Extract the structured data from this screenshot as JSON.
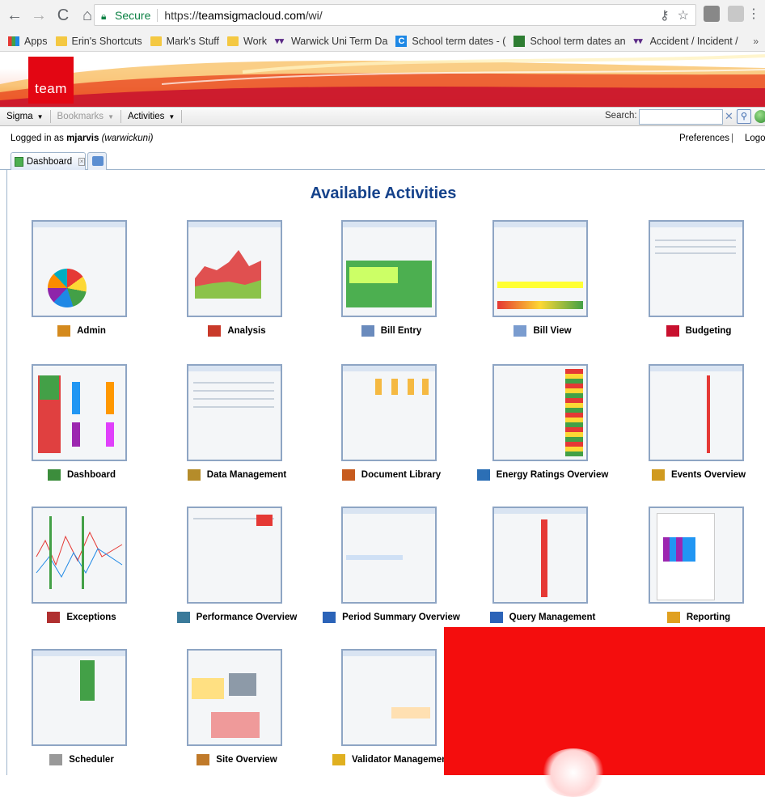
{
  "browser": {
    "secure_label": "Secure",
    "url_scheme": "https://",
    "url_host": "teamsigmacloud.com",
    "url_path": "/wi/",
    "bookmarks": [
      {
        "label": "Apps",
        "icon": "apps-icon"
      },
      {
        "label": "Erin's Shortcuts",
        "icon": "folder-icon"
      },
      {
        "label": "Mark's Stuff",
        "icon": "folder-icon"
      },
      {
        "label": "Work",
        "icon": "folder-icon"
      },
      {
        "label": "Warwick Uni Term Da",
        "icon": "warwick-icon"
      },
      {
        "label": "School term dates - (",
        "icon": "c-icon"
      },
      {
        "label": "School term dates an",
        "icon": "gov-icon"
      },
      {
        "label": "Accident / Incident /",
        "icon": "warwick-icon"
      }
    ],
    "more_label": "»"
  },
  "brand": {
    "logo_text": "team",
    "accent": "#e30613"
  },
  "menu": {
    "items": [
      {
        "label": "Sigma",
        "enabled": true
      },
      {
        "label": "Bookmarks",
        "enabled": false
      },
      {
        "label": "Activities",
        "enabled": true
      }
    ],
    "search_label": "Search:",
    "search_value": ""
  },
  "user": {
    "prefix": "Logged in as",
    "username": "mjarvis",
    "institution": "(warwickuni)",
    "preferences": "Preferences",
    "separator": "|",
    "logout": "Logou"
  },
  "tabs": [
    {
      "label": "Dashboard"
    }
  ],
  "page": {
    "title": "Available Activities"
  },
  "activities": [
    {
      "label": "Admin",
      "icon": "admin-icon"
    },
    {
      "label": "Analysis",
      "icon": "analysis-icon"
    },
    {
      "label": "Bill Entry",
      "icon": "bill-entry-icon"
    },
    {
      "label": "Bill View",
      "icon": "bill-view-icon"
    },
    {
      "label": "Budgeting",
      "icon": "budgeting-icon"
    },
    {
      "label": "Dashboard",
      "icon": "dashboard-icon"
    },
    {
      "label": "Data Management",
      "icon": "data-management-icon"
    },
    {
      "label": "Document Library",
      "icon": "document-library-icon"
    },
    {
      "label": "Energy Ratings Overview",
      "icon": "energy-ratings-icon"
    },
    {
      "label": "Events Overview",
      "icon": "events-icon"
    },
    {
      "label": "Exceptions",
      "icon": "exceptions-icon"
    },
    {
      "label": "Performance Overview",
      "icon": "performance-icon"
    },
    {
      "label": "Period Summary Overview",
      "icon": "period-summary-icon"
    },
    {
      "label": "Query Management",
      "icon": "query-icon"
    },
    {
      "label": "Reporting",
      "icon": "reporting-icon"
    },
    {
      "label": "Scheduler",
      "icon": "scheduler-icon"
    },
    {
      "label": "Site Overview",
      "icon": "site-overview-icon"
    },
    {
      "label": "Validator Management",
      "icon": "validator-icon"
    }
  ]
}
